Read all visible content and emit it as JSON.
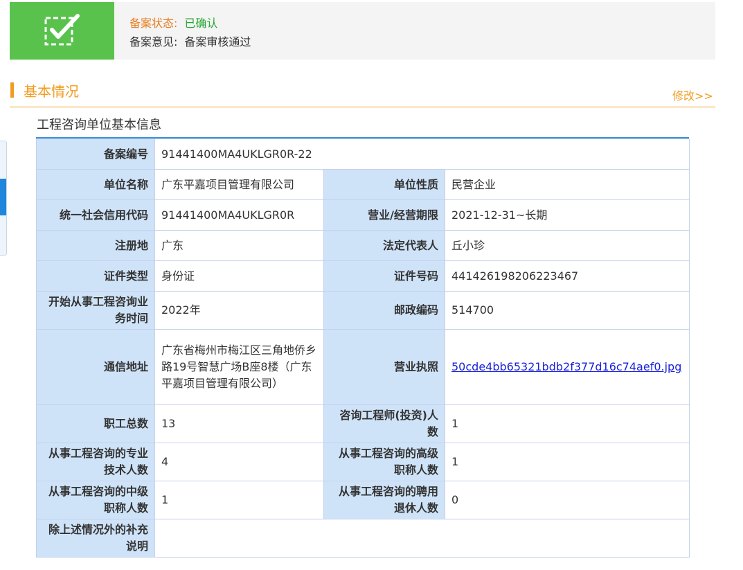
{
  "status": {
    "status_label": "备案状态:",
    "status_value": "已确认",
    "opinion_label": "备案意见:",
    "opinion_value": "备案审核通过"
  },
  "section": {
    "title": "基本情况",
    "edit_link": "修改>>"
  },
  "subsection_title": "工程咨询单位基本信息",
  "fields": {
    "filing_no": {
      "label": "备案编号",
      "value": "91441400MA4UKLGR0R-22"
    },
    "unit_name": {
      "label": "单位名称",
      "value": "广东平嘉项目管理有限公司"
    },
    "unit_nature": {
      "label": "单位性质",
      "value": "民营企业"
    },
    "credit_code": {
      "label": "统一社会信用代码",
      "value": "91441400MA4UKLGR0R"
    },
    "business_term": {
      "label": "营业/经营期限",
      "value": "2021-12-31~长期"
    },
    "registered_place": {
      "label": "注册地",
      "value": "广东"
    },
    "legal_rep": {
      "label": "法定代表人",
      "value": "丘小珍"
    },
    "id_type": {
      "label": "证件类型",
      "value": "身份证"
    },
    "id_number": {
      "label": "证件号码",
      "value": "441426198206223467"
    },
    "start_time": {
      "label": "开始从事工程咨询业务时间",
      "value": "2022年"
    },
    "postal_code": {
      "label": "邮政编码",
      "value": "514700"
    },
    "address": {
      "label": "通信地址",
      "value": "广东省梅州市梅江区三角地侨乡路19号智慧广场B座8楼（广东平嘉项目管理有限公司）"
    },
    "license": {
      "label": "营业执照",
      "value": "50cde4bb65321bdb2f377d16c74aef0.jpg"
    },
    "total_staff": {
      "label": "职工总数",
      "value": "13"
    },
    "consult_engineers": {
      "label": "咨询工程师(投资)人数",
      "value": "1"
    },
    "prof_tech_staff": {
      "label": "从事工程咨询的专业技术人数",
      "value": "4"
    },
    "senior_title_staff": {
      "label": "从事工程咨询的高级职称人数",
      "value": "1"
    },
    "mid_title_staff": {
      "label": "从事工程咨询的中级职称人数",
      "value": "1"
    },
    "retired_staff": {
      "label": "从事工程咨询的聘用退休人数",
      "value": "0"
    },
    "supplement": {
      "label": "除上述情况外的补充说明",
      "value": ""
    }
  },
  "icons": {
    "status": "checkbox-check-icon"
  },
  "colors": {
    "accent_orange": "#f29c1f",
    "status_green": "#59c24d",
    "header_blue": "#cfe3f8",
    "link_blue": "#1a22d6"
  }
}
